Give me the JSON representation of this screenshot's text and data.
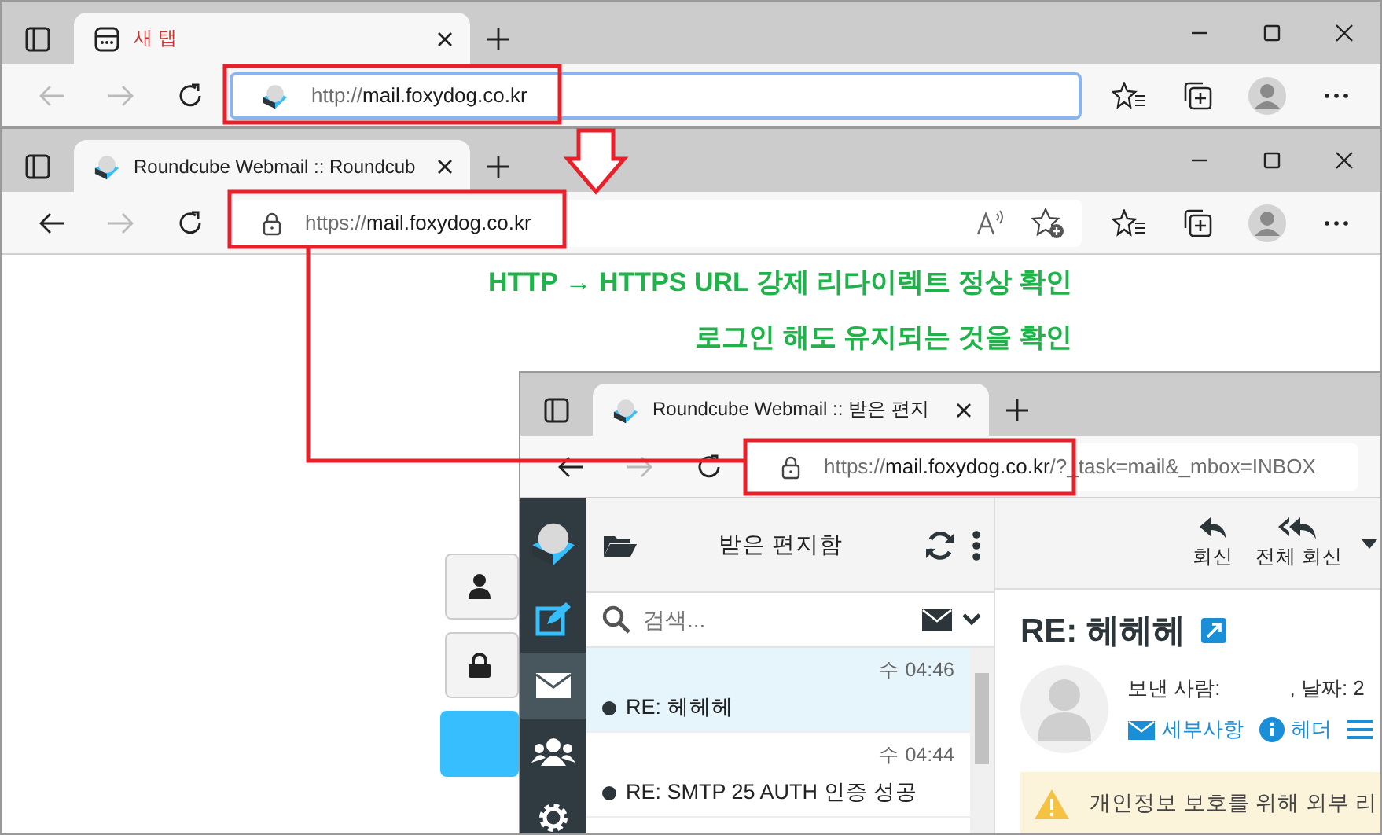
{
  "windows": [
    {
      "tabs": [
        {
          "title": "새 탭",
          "kind": "newtab",
          "selected": true
        }
      ],
      "url": {
        "scheme": "http://",
        "host": "mail.foxydog.co.kr"
      },
      "focused": true,
      "controls": true
    },
    {
      "tabs": [
        {
          "title": "Roundcube Webmail :: Roundcub",
          "kind": "page",
          "selected": true
        }
      ],
      "url": {
        "scheme": "https://",
        "host": "mail.foxydog.co.kr"
      },
      "focused": false,
      "controls": true,
      "content": {
        "kind": "login"
      }
    },
    {
      "tabs": [
        {
          "title": "Roundcube Webmail :: 받은 편지",
          "kind": "page",
          "selected": true
        }
      ],
      "url": {
        "scheme": "https://",
        "host": "mail.foxydog.co.kr",
        "path": "/?_task=mail&_mbox=INBOX"
      },
      "focused": false,
      "controls": false,
      "content": {
        "kind": "mail",
        "nav": [
          {
            "kind": "compose",
            "selected": false
          },
          {
            "kind": "mail",
            "selected": true
          },
          {
            "kind": "contacts",
            "selected": false
          },
          {
            "kind": "settings",
            "selected": false
          }
        ],
        "folder": "받은 편지함",
        "search_placeholder": "검색...",
        "messages": [
          {
            "date": "수 04:46",
            "subject": "RE: 헤헤헤",
            "selected": true
          },
          {
            "date": "수 04:44",
            "subject": "RE: SMTP 25 AUTH 인증 성공",
            "selected": false
          }
        ],
        "actions": [
          {
            "label": "회신",
            "kind": "reply"
          },
          {
            "label": "전체 회신",
            "kind": "reply-all"
          }
        ],
        "subject": "RE: 헤헤헤",
        "from_label": "보낸 사람:",
        "date_label": ", 날짜: 2",
        "links": [
          {
            "label": "세부사항",
            "kind": "details"
          },
          {
            "label": "헤더",
            "kind": "headers"
          },
          {
            "kind": "list"
          }
        ],
        "notice": "개인정보 보호를 위해 외부 리"
      }
    }
  ],
  "annotation_text": [
    "HTTP → HTTPS URL 강제 리다이렉트 정상 확인",
    "로그인 해도 유지되는 것을 확인"
  ]
}
